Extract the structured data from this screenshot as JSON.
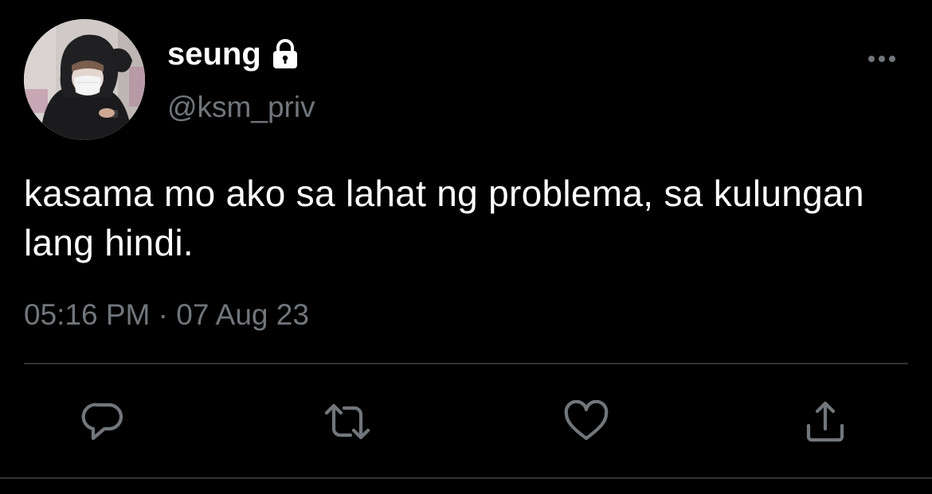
{
  "user": {
    "display_name": "seung",
    "handle": "@ksm_priv",
    "protected": true,
    "avatar_icon": "avatar-photo"
  },
  "tweet": {
    "text": "kasama mo ako sa lahat ng problema, sa kulungan lang hindi.",
    "time": "05:16 PM",
    "separator": "·",
    "date": "07 Aug 23"
  },
  "icons": {
    "more": "more-horizontal-icon",
    "lock": "lock-icon",
    "reply": "reply-icon",
    "retweet": "retweet-icon",
    "like": "heart-icon",
    "share": "share-icon"
  },
  "colors": {
    "background": "#000000",
    "primary_text": "#ffffff",
    "secondary_text": "#71767b",
    "divider": "#2f3336"
  }
}
